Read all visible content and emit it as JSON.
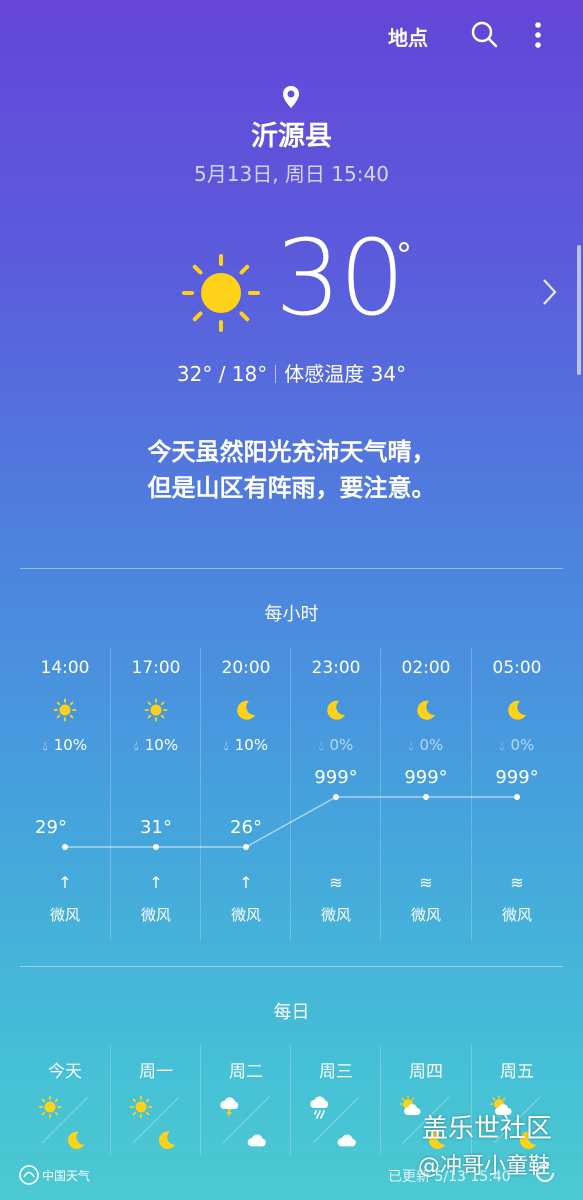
{
  "header": {
    "location_label": "地点",
    "icons": [
      "search-icon",
      "more-vert-icon",
      "location-pin-icon"
    ]
  },
  "current": {
    "city": "沂源县",
    "datetime": "5月13日, 周日 15:40",
    "temp": "30",
    "degree": "°",
    "hi_lo": "32° / 18°",
    "feels_like": "体感温度 34°",
    "summary_line1": "今天虽然阳光充沛天气晴，",
    "summary_line2": "但是山区有阵雨，要注意。",
    "condition_icon": "sunny-icon"
  },
  "hourly": {
    "title": "每小时",
    "items": [
      {
        "time": "14:00",
        "icon": "sun-icon",
        "precip": "10%",
        "temp": "29°",
        "temp_value": 29,
        "wind_icon": "↑",
        "wind": "微风"
      },
      {
        "time": "17:00",
        "icon": "sun-icon",
        "precip": "10%",
        "temp": "31°",
        "temp_value": 31,
        "wind_icon": "↑",
        "wind": "微风"
      },
      {
        "time": "20:00",
        "icon": "moon-icon",
        "precip": "10%",
        "temp": "26°",
        "temp_value": 26,
        "wind_icon": "↑",
        "wind": "微风"
      },
      {
        "time": "23:00",
        "icon": "moon-icon",
        "precip": "0%",
        "temp": "999°",
        "temp_value": 999,
        "wind_icon": "≋",
        "wind": "微风"
      },
      {
        "time": "02:00",
        "icon": "moon-icon",
        "precip": "0%",
        "temp": "999°",
        "temp_value": 999,
        "wind_icon": "≋",
        "wind": "微风"
      },
      {
        "time": "05:00",
        "icon": "moon-icon",
        "precip": "0%",
        "temp": "999°",
        "temp_value": 999,
        "wind_icon": "≋",
        "wind": "微风"
      }
    ]
  },
  "daily": {
    "title": "每日",
    "items": [
      {
        "day": "今天",
        "day_icon": "sun-icon",
        "night_icon": "moon-icon"
      },
      {
        "day": "周一",
        "day_icon": "sun-icon",
        "night_icon": "moon-icon"
      },
      {
        "day": "周二",
        "day_icon": "thunderstorm-icon",
        "night_icon": "cloud-icon"
      },
      {
        "day": "周三",
        "day_icon": "rain-icon",
        "night_icon": "cloud-icon"
      },
      {
        "day": "周四",
        "day_icon": "partly-cloudy-icon",
        "night_icon": "moon-icon"
      },
      {
        "day": "周五",
        "day_icon": "partly-cloudy-icon",
        "night_icon": "moon-icon"
      }
    ]
  },
  "footer": {
    "provider": "中国天气",
    "updated": "已更新 5/13 15:40"
  },
  "watermark": {
    "line1": "盖乐世社区",
    "line2": "@冲哥小童鞋"
  },
  "colors": {
    "sun": "#ffd21a",
    "gradient_top": "#6446d8",
    "gradient_bottom": "#4cc9d2"
  }
}
